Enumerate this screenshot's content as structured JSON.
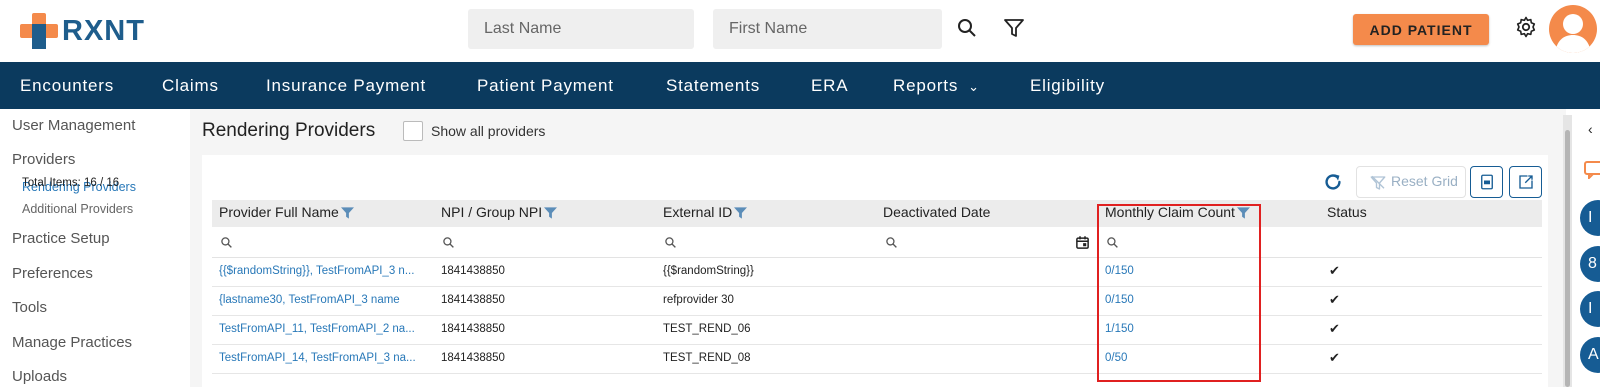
{
  "header": {
    "brand": "RXNT",
    "last_name_placeholder": "Last Name",
    "first_name_placeholder": "First Name",
    "add_patient_label": "ADD PATIENT"
  },
  "nav": {
    "items": [
      "Encounters",
      "Claims",
      "Insurance Payment",
      "Patient Payment",
      "Statements",
      "ERA",
      "Reports",
      "Eligibility"
    ]
  },
  "sidebar": {
    "user_management": "User Management",
    "providers": "Providers",
    "rendering_providers": "Rendering Providers",
    "additional_providers": "Additional Providers",
    "practice_setup": "Practice Setup",
    "preferences": "Preferences",
    "tools": "Tools",
    "manage_practices": "Manage Practices",
    "uploads": "Uploads"
  },
  "page": {
    "title": "Rendering Providers",
    "show_all_label": "Show all providers",
    "total_items": "Total Items: 16 / 16",
    "reset_grid_label": "Reset Grid"
  },
  "grid": {
    "columns": [
      "Provider Full Name",
      "NPI / Group NPI",
      "External ID",
      "Deactivated Date",
      "Monthly Claim Count",
      "Status"
    ],
    "rows": [
      {
        "name": "{{$randomString}}, TestFromAPI_3 n...",
        "npi": "1841438850",
        "external_id": "{{$randomString}}",
        "deactivated": "",
        "claim_count": "0/150",
        "status": "✔"
      },
      {
        "name": "{lastname30, TestFromAPI_3 name",
        "npi": "1841438850",
        "external_id": "refprovider 30",
        "deactivated": "",
        "claim_count": "0/150",
        "status": "✔"
      },
      {
        "name": "TestFromAPI_11, TestFromAPI_2 na...",
        "npi": "1841438850",
        "external_id": "TEST_REND_06",
        "deactivated": "",
        "claim_count": "1/150",
        "status": "✔"
      },
      {
        "name": "TestFromAPI_14, TestFromAPI_3 na...",
        "npi": "1841438850",
        "external_id": "TEST_REND_08",
        "deactivated": "",
        "claim_count": "0/50",
        "status": "✔"
      }
    ]
  },
  "right_rail": {
    "circles": [
      "I",
      "8",
      "I",
      "A"
    ]
  },
  "colors": {
    "nav_bg": "#0b3a5e",
    "accent_orange": "#f48a4b",
    "link_blue": "#2878b8",
    "highlight_red": "#e02020"
  }
}
